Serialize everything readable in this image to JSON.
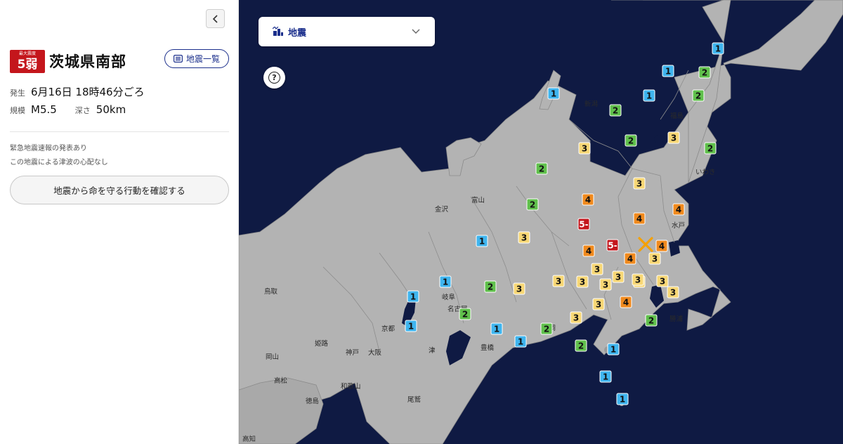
{
  "sidebar": {
    "intensity_caption": "最大震度",
    "intensity_value": "5弱",
    "area_name": "茨城県南部",
    "list_button_label": "地震一覧",
    "occurrence_label": "発生",
    "occurrence_value": "6月16日 18時46分ごろ",
    "magnitude_label": "規模",
    "magnitude_value": "M5.5",
    "depth_label": "深さ",
    "depth_value": "50km",
    "notes": [
      "緊急地震速報の発表あり",
      "この地震による津波の心配なし"
    ],
    "action_button_label": "地震から命を守る行動を確認する",
    "collapse_icon": "chevron-left-icon"
  },
  "map": {
    "layer_select_label": "地震",
    "layer_icon": "seismic-layer-icon",
    "help_icon": "question-icon",
    "epicenter_icon": "epicenter-cross-icon",
    "colors": {
      "ocean": "#0f1a43",
      "land": "#b3b3b3",
      "intensity_1": "#3fb5ef",
      "intensity_2": "#60c04c",
      "intensity_3": "#f7d775",
      "intensity_4": "#f08a1e",
      "intensity_5_lower": "#c4161c",
      "epicenter": "#f5a000"
    },
    "cities": [
      "新潟",
      "福島",
      "いわき",
      "水戸",
      "富山",
      "金沢",
      "岐阜",
      "名古屋",
      "豊橋",
      "静岡",
      "津",
      "京都",
      "大阪",
      "神戸",
      "姫路",
      "岡山",
      "鳥取",
      "高松",
      "徳島",
      "和歌山",
      "尾鷲",
      "高知",
      "勝浦"
    ],
    "markers": [
      {
        "level": "1"
      },
      {
        "level": "1"
      },
      {
        "level": "1"
      },
      {
        "level": "1"
      },
      {
        "level": "1"
      },
      {
        "level": "1"
      },
      {
        "level": "1"
      },
      {
        "level": "1"
      },
      {
        "level": "1"
      },
      {
        "level": "1"
      },
      {
        "level": "1"
      },
      {
        "level": "1"
      },
      {
        "level": "1"
      },
      {
        "level": "2"
      },
      {
        "level": "2"
      },
      {
        "level": "2"
      },
      {
        "level": "2"
      },
      {
        "level": "2"
      },
      {
        "level": "2"
      },
      {
        "level": "2"
      },
      {
        "level": "2"
      },
      {
        "level": "2"
      },
      {
        "level": "2"
      },
      {
        "level": "2"
      },
      {
        "level": "2"
      },
      {
        "level": "3"
      },
      {
        "level": "3"
      },
      {
        "level": "3"
      },
      {
        "level": "3"
      },
      {
        "level": "3"
      },
      {
        "level": "3"
      },
      {
        "level": "3"
      },
      {
        "level": "3"
      },
      {
        "level": "3"
      },
      {
        "level": "3"
      },
      {
        "level": "3"
      },
      {
        "level": "3"
      },
      {
        "level": "3"
      },
      {
        "level": "3"
      },
      {
        "level": "3"
      },
      {
        "level": "3"
      },
      {
        "level": "3"
      },
      {
        "level": "4"
      },
      {
        "level": "4"
      },
      {
        "level": "4"
      },
      {
        "level": "4"
      },
      {
        "level": "4"
      },
      {
        "level": "4"
      },
      {
        "level": "4"
      },
      {
        "level": "5-"
      },
      {
        "level": "5-"
      }
    ]
  }
}
